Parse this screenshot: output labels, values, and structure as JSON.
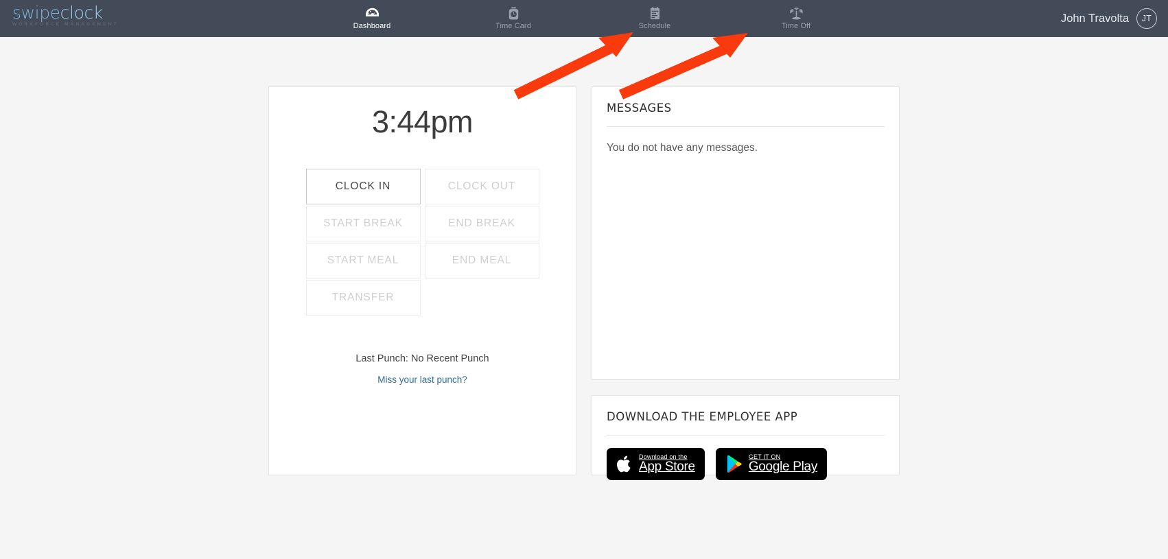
{
  "brand": {
    "logo_main": "swipeclock",
    "logo_main_light": "clock",
    "logo_main_dark": "swipe",
    "logo_sub": "WORKFORCE MANAGEMENT",
    "logo_color": "#7fb4d8",
    "topbar_color": "#434a58"
  },
  "nav": {
    "items": [
      {
        "label": "Dashboard",
        "icon": "gauge-icon",
        "active": true
      },
      {
        "label": "Time Card",
        "icon": "stopwatch-icon",
        "active": false
      },
      {
        "label": "Schedule",
        "icon": "calendar-clipboard-icon",
        "active": false
      },
      {
        "label": "Time Off",
        "icon": "palm-tree-icon",
        "active": false
      }
    ]
  },
  "user": {
    "name": "John Travolta",
    "initials": "JT"
  },
  "clock_card": {
    "time": "3:44pm",
    "buttons": [
      {
        "label": "CLOCK IN",
        "enabled": true
      },
      {
        "label": "CLOCK OUT",
        "enabled": false
      },
      {
        "label": "START BREAK",
        "enabled": false
      },
      {
        "label": "END BREAK",
        "enabled": false
      },
      {
        "label": "START MEAL",
        "enabled": false
      },
      {
        "label": "END MEAL",
        "enabled": false
      },
      {
        "label": "TRANSFER",
        "enabled": false
      }
    ],
    "last_punch": "Last Punch: No Recent Punch",
    "miss_punch_link": "Miss your last punch?",
    "link_color": "#2f6b9b"
  },
  "messages_card": {
    "title": "MESSAGES",
    "empty_text": "You do not have any messages."
  },
  "download_card": {
    "title": "DOWNLOAD THE EMPLOYEE APP",
    "badges": [
      {
        "small": "Download on the",
        "big": "App Store",
        "icon": "apple-icon"
      },
      {
        "small": "GET IT ON",
        "big": "Google Play",
        "icon": "google-play-icon"
      }
    ]
  },
  "annotations": {
    "color": "#f93a0c",
    "arrows": [
      {
        "name": "arrow-to-schedule",
        "target": "Schedule"
      },
      {
        "name": "arrow-to-time-off",
        "target": "Time Off"
      }
    ]
  }
}
